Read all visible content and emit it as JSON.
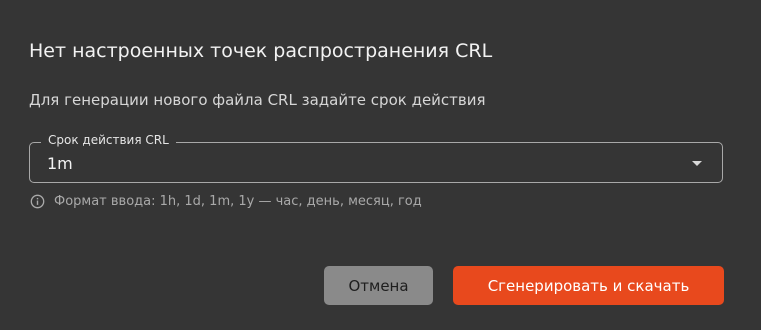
{
  "dialog": {
    "title": "Нет настроенных точек распространения CRL",
    "description": "Для генерации нового файла CRL задайте срок действия",
    "field": {
      "label": "Срок действия CRL",
      "value": "1m",
      "icon": "chevron-down-icon"
    },
    "hint": {
      "icon": "info-icon",
      "text": "Формат ввода: 1h, 1d, 1m, 1y — час, день, месяц, год"
    },
    "buttons": {
      "cancel_label": "Отмена",
      "submit_label": "Сгенерировать и скачать"
    },
    "colors": {
      "background": "#353535",
      "accent": "#e8491d",
      "secondary_button": "#8a8a8a"
    }
  }
}
